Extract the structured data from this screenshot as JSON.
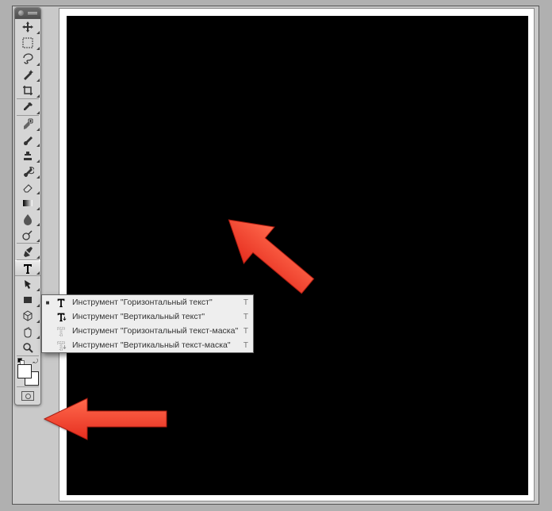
{
  "tools": [
    {
      "name": "move-tool",
      "icon": "move",
      "fly": true
    },
    {
      "name": "marquee-tool",
      "icon": "marquee",
      "fly": true
    },
    {
      "name": "lasso-tool",
      "icon": "lasso",
      "fly": true
    },
    {
      "name": "magic-wand-tool",
      "icon": "wand",
      "fly": true
    },
    {
      "name": "crop-tool",
      "icon": "crop",
      "fly": true
    },
    {
      "name": "eyedropper-tool",
      "icon": "eyedrop",
      "fly": true
    },
    {
      "name": "healing-brush-tool",
      "icon": "heal",
      "fly": true
    },
    {
      "name": "brush-tool",
      "icon": "brush",
      "fly": true
    },
    {
      "name": "clone-stamp-tool",
      "icon": "stamp",
      "fly": true
    },
    {
      "name": "history-brush-tool",
      "icon": "history",
      "fly": true
    },
    {
      "name": "eraser-tool",
      "icon": "eraser",
      "fly": true
    },
    {
      "name": "gradient-tool",
      "icon": "gradient",
      "fly": true
    },
    {
      "name": "blur-tool",
      "icon": "blur",
      "fly": true
    },
    {
      "name": "dodge-tool",
      "icon": "dodge",
      "fly": true
    },
    {
      "name": "pen-tool",
      "icon": "pen",
      "fly": true
    },
    {
      "name": "type-tool",
      "icon": "type",
      "fly": true,
      "active": true
    },
    {
      "name": "path-select-tool",
      "icon": "pathsel",
      "fly": true
    },
    {
      "name": "shape-tool",
      "icon": "rect",
      "fly": true
    },
    {
      "name": "3d-tool",
      "icon": "cube",
      "fly": true
    },
    {
      "name": "hand-tool",
      "icon": "hand",
      "fly": true
    },
    {
      "name": "zoom-tool",
      "icon": "zoom",
      "fly": false
    }
  ],
  "flyout": {
    "items": [
      {
        "label": "Инструмент \"Горизонтальный текст\"",
        "key": "T",
        "icon": "type-h",
        "active": true
      },
      {
        "label": "Инструмент \"Вертикальный текст\"",
        "key": "T",
        "icon": "type-v",
        "active": false
      },
      {
        "label": "Инструмент \"Горизонтальный текст-маска\"",
        "key": "T",
        "icon": "type-hm",
        "active": false
      },
      {
        "label": "Инструмент \"Вертикальный текст-маска\"",
        "key": "T",
        "icon": "type-vm",
        "active": false
      }
    ]
  },
  "colors": {
    "foreground": "#ffffff",
    "background": "#ffffff"
  }
}
